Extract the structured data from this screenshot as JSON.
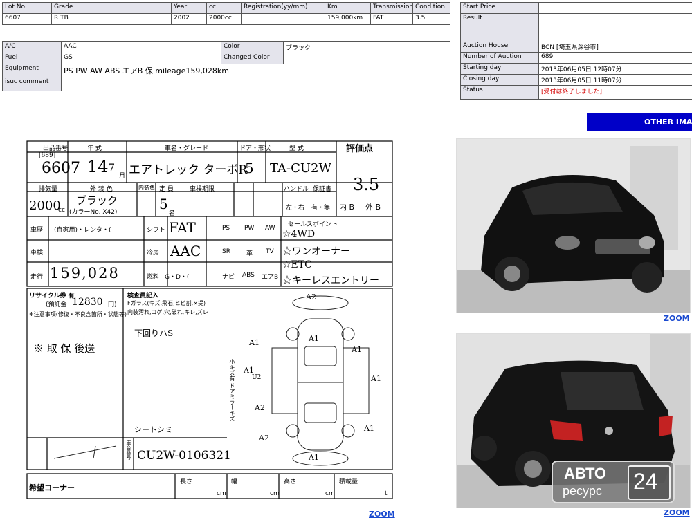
{
  "top_table": {
    "headers": [
      "Lot No.",
      "Grade",
      "Year",
      "cc",
      "Registration(yy/mm)",
      "Km",
      "Transmission",
      "Condition"
    ],
    "values": [
      "6607",
      "R TB",
      "2002",
      "2000cc",
      "",
      "159,000km",
      "FAT",
      "3.5"
    ]
  },
  "detail_table": {
    "ac_label": "A/C",
    "ac_value": "AAC",
    "color_label": "Color",
    "color_value": "ブラック",
    "fuel_label": "Fuel",
    "fuel_value": "GS",
    "changed_color_label": "Changed Color",
    "changed_color_value": "",
    "equipment_label": "Equipment",
    "equipment_value": "PS PW AW ABS エアB 保  mileage159,028km",
    "comment_label": "isuc comment",
    "comment_value": ""
  },
  "auction_table": {
    "start_price_label": "Start Price",
    "start_price_value": "",
    "result_label": "Result",
    "result_value": "",
    "house_label": "Auction House",
    "house_value": "BCN [埼玉県深谷市]",
    "number_label": "Number of Auction",
    "number_value": "689",
    "start_day_label": "Starting day",
    "start_day_value": "2013年06月05日 12時07分",
    "close_day_label": "Closing day",
    "close_day_value": "2013年06月05日 11時07分",
    "status_label": "Status",
    "status_value": "[受付は終了しました]"
  },
  "other_images_button": "OTHER IMAGES",
  "zoom_label": "ZOOM",
  "sheet": {
    "h_lot": "出品番号",
    "h_year": "年 式",
    "h_name": "車名・グレード",
    "h_door": "ドア・形状",
    "h_model": "型 式",
    "h_score": "評価点",
    "lot_small": "[689]",
    "lot": "6607",
    "year": "14",
    "month": "7",
    "month_unit": "月",
    "grade": "エアトレック ターボR",
    "door": "5",
    "model": "TA-CU2W",
    "score": "3.5",
    "h_cc": "排気量",
    "h_color": "外 装 色",
    "h_inside": "内装色",
    "h_cap": "定 員",
    "h_validity": "車検期限",
    "h_handle": "ハンドル",
    "h_warranty": "保証書",
    "cc": "2000",
    "cc_unit": "cc",
    "color": "ブラック",
    "color_code": "(カラーNo. X42)",
    "capacity": "5",
    "capacity_unit": "名",
    "handle": "左・右",
    "warranty": "有・無",
    "interior": "内 B",
    "exterior": "外 B",
    "row_history": "車歴",
    "history_value": "(自家用)・レンタ・(",
    "row_shift": "シフト",
    "shift": "FAT",
    "row_check": "車検",
    "row_ac": "冷房",
    "ac": "AAC",
    "row_mileage": "走行",
    "mileage": "159,028",
    "row_fuel": "燃料",
    "fuel": "G・D・(",
    "equip": [
      "PS",
      "PW",
      "AW",
      "SR",
      "革",
      "TV",
      "ナビ",
      "ABS",
      "エアB"
    ],
    "sales_header": "セールスポイント",
    "sales_points": [
      "☆4WD",
      "☆ワンオーナー",
      "☆ETC",
      "☆キーレスエントリー"
    ],
    "recycle": "リサイクル券 有",
    "recycle_fee_label": "(預託金",
    "recycle_fee": "12830",
    "recycle_unit": "円)",
    "notes_label": "※注意事項(修復・不良含箇所・状態等)",
    "inspector_label": "検査員記入",
    "inspector_lines": [
      "Fガラス(キズ,飛石,ヒビ割,×提)",
      "内装汚れ,コゲ,穴,破れ,キレ,ズレ",
      "下回りハS",
      "シートシミ"
    ],
    "note_handwritten": "※ 取 保 後送",
    "vin_label": "車台番号",
    "vin": "CU2W-0106321",
    "side_label": "小キズ有 ドアミラーキズ",
    "dmg": [
      "A2",
      "A1",
      "A1",
      "A1",
      "A1",
      "A1",
      "A1",
      "A2",
      "A2",
      "A1",
      "U2"
    ],
    "wish_label": "希望コーナー",
    "length_label": "長さ",
    "width_label": "幅",
    "height_label": "高さ",
    "load_label": "積載量",
    "cm": "cm",
    "t": "t"
  },
  "watermark": {
    "line1": "АВТО",
    "line2": "ресурс",
    "num": "24"
  }
}
